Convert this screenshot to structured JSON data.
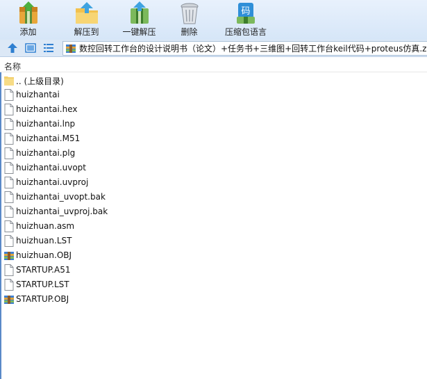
{
  "toolbar": {
    "add_label": "添加",
    "extract_label": "解压到",
    "one_click_label": "一键解压",
    "delete_label": "删除",
    "zip_lang_label": "压缩包语言",
    "zip_lang_icon_text": "码"
  },
  "address": {
    "path": "数控回转工作台的设计说明书（论文）+任务书+三维图+回转工作台keil代码+proteus仿真.zip"
  },
  "columns": {
    "name": "名称"
  },
  "files": [
    {
      "name": ".. (上级目录)",
      "icon": "folder-icon"
    },
    {
      "name": "huizhantai",
      "icon": "file-icon"
    },
    {
      "name": "huizhantai.hex",
      "icon": "file-icon"
    },
    {
      "name": "huizhantai.lnp",
      "icon": "file-icon"
    },
    {
      "name": "huizhantai.M51",
      "icon": "file-icon"
    },
    {
      "name": "huizhantai.plg",
      "icon": "file-icon"
    },
    {
      "name": "huizhantai.uvopt",
      "icon": "file-icon"
    },
    {
      "name": "huizhantai.uvproj",
      "icon": "file-icon"
    },
    {
      "name": "huizhantai_uvopt.bak",
      "icon": "file-icon"
    },
    {
      "name": "huizhantai_uvproj.bak",
      "icon": "file-icon"
    },
    {
      "name": "huizhuan.asm",
      "icon": "file-icon"
    },
    {
      "name": "huizhuan.LST",
      "icon": "file-icon"
    },
    {
      "name": "huizhuan.OBJ",
      "icon": "archive-icon"
    },
    {
      "name": "STARTUP.A51",
      "icon": "file-icon"
    },
    {
      "name": "STARTUP.LST",
      "icon": "file-icon"
    },
    {
      "name": "STARTUP.OBJ",
      "icon": "archive-icon"
    }
  ],
  "colors": {
    "toolbar_bg": "#dbe8f7",
    "accent_blue": "#2f6fbf"
  }
}
